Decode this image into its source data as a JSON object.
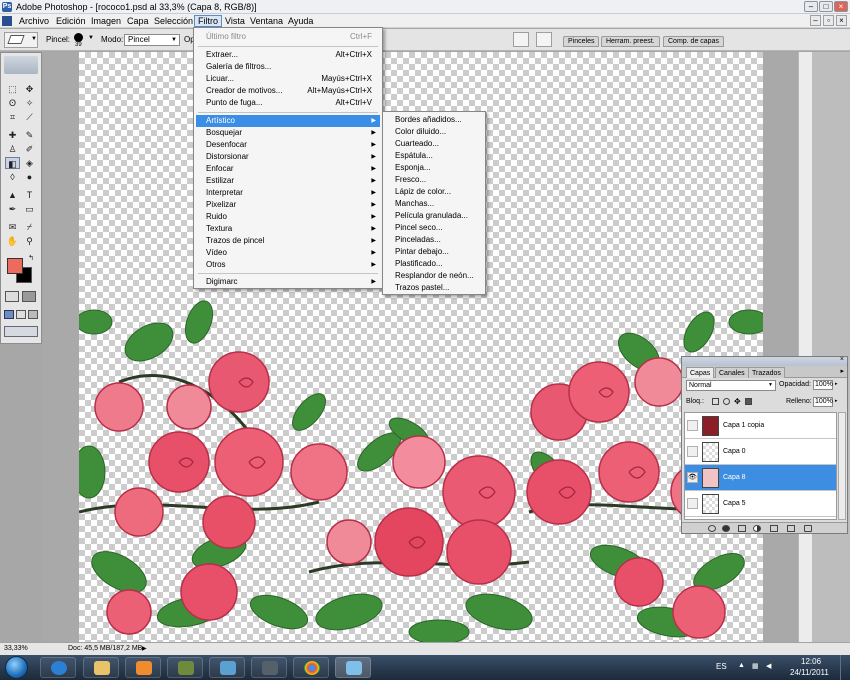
{
  "window": {
    "title": "Adobe Photoshop - [rococo1.psd al 33,3% (Capa 8, RGB/8)]"
  },
  "menubar": {
    "items": [
      "Archivo",
      "Edición",
      "Imagen",
      "Capa",
      "Selección",
      "Filtro",
      "Vista",
      "Ventana",
      "Ayuda"
    ],
    "active": "Filtro"
  },
  "options_bar": {
    "brush_label": "Pincel:",
    "brush_size": "39",
    "mode_label": "Modo:",
    "mode_value": "Pincel",
    "opacity_label_partial": "Op",
    "palette_tabs": [
      "Pinceles",
      "Herram. preest.",
      "Comp. de capas"
    ]
  },
  "filter_menu": {
    "last_filter": {
      "label": "Último filtro",
      "shortcut": "Ctrl+F"
    },
    "top_items": [
      {
        "label": "Extraer...",
        "shortcut": "Alt+Ctrl+X"
      },
      {
        "label": "Galería de filtros...",
        "shortcut": ""
      },
      {
        "label": "Licuar...",
        "shortcut": "Mayús+Ctrl+X"
      },
      {
        "label": "Creador de motivos...",
        "shortcut": "Alt+Mayús+Ctrl+X"
      },
      {
        "label": "Punto de fuga...",
        "shortcut": "Alt+Ctrl+V"
      }
    ],
    "categories": [
      "Artístico",
      "Bosquejar",
      "Desenfocar",
      "Distorsionar",
      "Enfocar",
      "Estilizar",
      "Interpretar",
      "Pixelizar",
      "Ruido",
      "Textura",
      "Trazos de pincel",
      "Vídeo",
      "Otros"
    ],
    "highlighted_category": "Artístico",
    "bottom_item": "Digimarc"
  },
  "artistic_submenu": {
    "items": [
      "Bordes añadidos...",
      "Color diluido...",
      "Cuarteado...",
      "Espátula...",
      "Esponja...",
      "Fresco...",
      "Lápiz de color...",
      "Manchas...",
      "Película granulada...",
      "Pincel seco...",
      "Pinceladas...",
      "Pintar debajo...",
      "Plastificado...",
      "Resplandor de neón...",
      "Trazos pastel..."
    ]
  },
  "layers_panel": {
    "tabs": [
      "Capas",
      "Canales",
      "Trazados"
    ],
    "active_tab": "Capas",
    "blend_mode": "Normal",
    "opacity_label": "Opacidad:",
    "opacity_value": "100%",
    "lock_label": "Bloq.:",
    "fill_label": "Relleno:",
    "fill_value": "100%",
    "layers": [
      {
        "name": "Capa 1 copia",
        "visible": false,
        "selected": false
      },
      {
        "name": "Capa 0",
        "visible": false,
        "selected": false
      },
      {
        "name": "Capa 8",
        "visible": true,
        "selected": true
      },
      {
        "name": "Capa 5",
        "visible": false,
        "selected": false
      }
    ]
  },
  "status_bar": {
    "zoom": "33,33%",
    "doc_info": "Doc: 45,5 MB/187,2 MB"
  },
  "taskbar": {
    "language": "ES",
    "time": "12:06",
    "date": "24/11/2011"
  },
  "colors": {
    "foreground": "#ec6a5e",
    "background": "#000000",
    "menu_highlight": "#3a8ee6",
    "rose": "#e8506a",
    "leaf": "#3f8f3a"
  }
}
